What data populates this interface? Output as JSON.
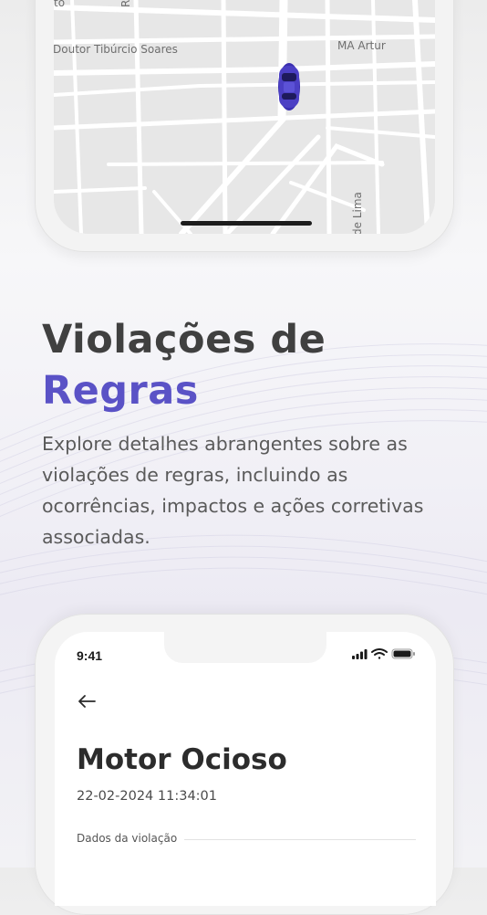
{
  "map": {
    "labels": {
      "street_top_left": "to",
      "street_doutor": "Doutor Tibúrcio Soares",
      "street_rua": "Rua L",
      "street_ma_artur": "MA Artur",
      "street_de_lima": "de Lima"
    }
  },
  "headline": {
    "line1": "Violações de",
    "line2": "Regras",
    "description": "Explore detalhes abrangentes sobre as violações de regras, incluindo as ocorrências, impactos e ações corretivas associadas."
  },
  "phone_screen": {
    "status_time": "9:41",
    "title": "Motor Ocioso",
    "date": "22-02-2024 11:34:01",
    "section_label": "Dados da violação"
  },
  "colors": {
    "accent": "#5a52c6",
    "title_dark": "#404040",
    "car": "#4b3fc4"
  }
}
